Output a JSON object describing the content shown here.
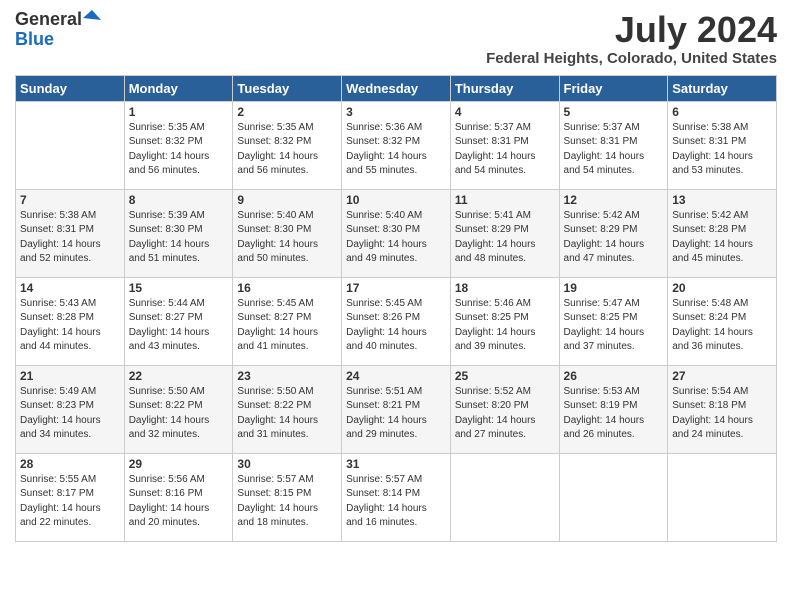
{
  "logo": {
    "general": "General",
    "blue": "Blue"
  },
  "title": "July 2024",
  "location": "Federal Heights, Colorado, United States",
  "weekdays": [
    "Sunday",
    "Monday",
    "Tuesday",
    "Wednesday",
    "Thursday",
    "Friday",
    "Saturday"
  ],
  "weeks": [
    [
      {
        "day": "",
        "info": ""
      },
      {
        "day": "1",
        "info": "Sunrise: 5:35 AM\nSunset: 8:32 PM\nDaylight: 14 hours\nand 56 minutes."
      },
      {
        "day": "2",
        "info": "Sunrise: 5:35 AM\nSunset: 8:32 PM\nDaylight: 14 hours\nand 56 minutes."
      },
      {
        "day": "3",
        "info": "Sunrise: 5:36 AM\nSunset: 8:32 PM\nDaylight: 14 hours\nand 55 minutes."
      },
      {
        "day": "4",
        "info": "Sunrise: 5:37 AM\nSunset: 8:31 PM\nDaylight: 14 hours\nand 54 minutes."
      },
      {
        "day": "5",
        "info": "Sunrise: 5:37 AM\nSunset: 8:31 PM\nDaylight: 14 hours\nand 54 minutes."
      },
      {
        "day": "6",
        "info": "Sunrise: 5:38 AM\nSunset: 8:31 PM\nDaylight: 14 hours\nand 53 minutes."
      }
    ],
    [
      {
        "day": "7",
        "info": "Sunrise: 5:38 AM\nSunset: 8:31 PM\nDaylight: 14 hours\nand 52 minutes."
      },
      {
        "day": "8",
        "info": "Sunrise: 5:39 AM\nSunset: 8:30 PM\nDaylight: 14 hours\nand 51 minutes."
      },
      {
        "day": "9",
        "info": "Sunrise: 5:40 AM\nSunset: 8:30 PM\nDaylight: 14 hours\nand 50 minutes."
      },
      {
        "day": "10",
        "info": "Sunrise: 5:40 AM\nSunset: 8:30 PM\nDaylight: 14 hours\nand 49 minutes."
      },
      {
        "day": "11",
        "info": "Sunrise: 5:41 AM\nSunset: 8:29 PM\nDaylight: 14 hours\nand 48 minutes."
      },
      {
        "day": "12",
        "info": "Sunrise: 5:42 AM\nSunset: 8:29 PM\nDaylight: 14 hours\nand 47 minutes."
      },
      {
        "day": "13",
        "info": "Sunrise: 5:42 AM\nSunset: 8:28 PM\nDaylight: 14 hours\nand 45 minutes."
      }
    ],
    [
      {
        "day": "14",
        "info": "Sunrise: 5:43 AM\nSunset: 8:28 PM\nDaylight: 14 hours\nand 44 minutes."
      },
      {
        "day": "15",
        "info": "Sunrise: 5:44 AM\nSunset: 8:27 PM\nDaylight: 14 hours\nand 43 minutes."
      },
      {
        "day": "16",
        "info": "Sunrise: 5:45 AM\nSunset: 8:27 PM\nDaylight: 14 hours\nand 41 minutes."
      },
      {
        "day": "17",
        "info": "Sunrise: 5:45 AM\nSunset: 8:26 PM\nDaylight: 14 hours\nand 40 minutes."
      },
      {
        "day": "18",
        "info": "Sunrise: 5:46 AM\nSunset: 8:25 PM\nDaylight: 14 hours\nand 39 minutes."
      },
      {
        "day": "19",
        "info": "Sunrise: 5:47 AM\nSunset: 8:25 PM\nDaylight: 14 hours\nand 37 minutes."
      },
      {
        "day": "20",
        "info": "Sunrise: 5:48 AM\nSunset: 8:24 PM\nDaylight: 14 hours\nand 36 minutes."
      }
    ],
    [
      {
        "day": "21",
        "info": "Sunrise: 5:49 AM\nSunset: 8:23 PM\nDaylight: 14 hours\nand 34 minutes."
      },
      {
        "day": "22",
        "info": "Sunrise: 5:50 AM\nSunset: 8:22 PM\nDaylight: 14 hours\nand 32 minutes."
      },
      {
        "day": "23",
        "info": "Sunrise: 5:50 AM\nSunset: 8:22 PM\nDaylight: 14 hours\nand 31 minutes."
      },
      {
        "day": "24",
        "info": "Sunrise: 5:51 AM\nSunset: 8:21 PM\nDaylight: 14 hours\nand 29 minutes."
      },
      {
        "day": "25",
        "info": "Sunrise: 5:52 AM\nSunset: 8:20 PM\nDaylight: 14 hours\nand 27 minutes."
      },
      {
        "day": "26",
        "info": "Sunrise: 5:53 AM\nSunset: 8:19 PM\nDaylight: 14 hours\nand 26 minutes."
      },
      {
        "day": "27",
        "info": "Sunrise: 5:54 AM\nSunset: 8:18 PM\nDaylight: 14 hours\nand 24 minutes."
      }
    ],
    [
      {
        "day": "28",
        "info": "Sunrise: 5:55 AM\nSunset: 8:17 PM\nDaylight: 14 hours\nand 22 minutes."
      },
      {
        "day": "29",
        "info": "Sunrise: 5:56 AM\nSunset: 8:16 PM\nDaylight: 14 hours\nand 20 minutes."
      },
      {
        "day": "30",
        "info": "Sunrise: 5:57 AM\nSunset: 8:15 PM\nDaylight: 14 hours\nand 18 minutes."
      },
      {
        "day": "31",
        "info": "Sunrise: 5:57 AM\nSunset: 8:14 PM\nDaylight: 14 hours\nand 16 minutes."
      },
      {
        "day": "",
        "info": ""
      },
      {
        "day": "",
        "info": ""
      },
      {
        "day": "",
        "info": ""
      }
    ]
  ]
}
